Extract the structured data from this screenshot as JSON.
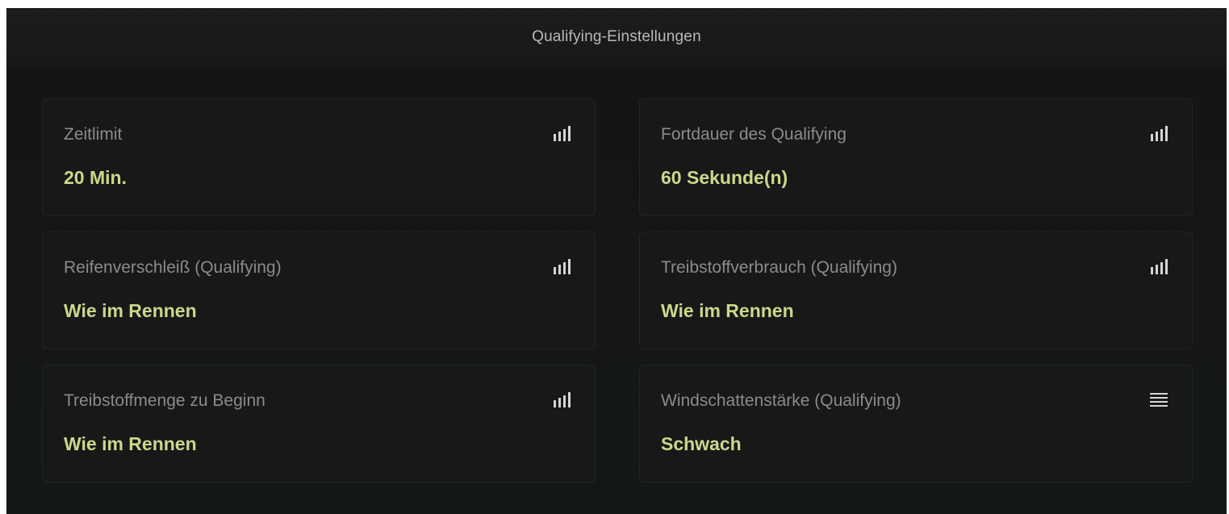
{
  "header": {
    "title": "Qualifying-Einstellungen"
  },
  "settings": [
    {
      "label": "Zeitlimit",
      "value": "20 Min.",
      "icon": "signal-bars-icon"
    },
    {
      "label": "Fortdauer des Qualifying",
      "value": "60 Sekunde(n)",
      "icon": "signal-bars-icon"
    },
    {
      "label": "Reifenverschleiß (Qualifying)",
      "value": "Wie im Rennen",
      "icon": "signal-bars-icon"
    },
    {
      "label": "Treibstoffverbrauch (Qualifying)",
      "value": "Wie im Rennen",
      "icon": "signal-bars-icon"
    },
    {
      "label": "Treibstoffmenge zu Beginn",
      "value": "Wie im Rennen",
      "icon": "signal-bars-icon"
    },
    {
      "label": "Windschattenstärke (Qualifying)",
      "value": "Schwach",
      "icon": "list-lines-icon"
    }
  ],
  "colors": {
    "background": "#151716",
    "card": "#171818",
    "label": "#8a8b8b",
    "value": "#cbd88a",
    "title": "#b9b9b9"
  }
}
